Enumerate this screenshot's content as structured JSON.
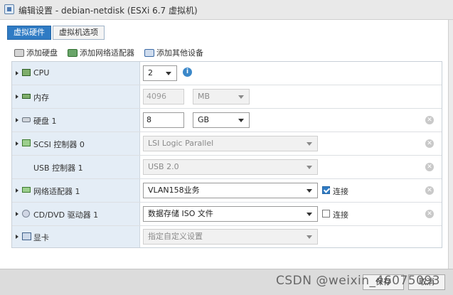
{
  "window": {
    "title": "编辑设置 - debian-netdisk (ESXi 6.7 虚拟机)"
  },
  "tabs": [
    {
      "label": "虚拟硬件",
      "active": true
    },
    {
      "label": "虚拟机选项",
      "active": false
    }
  ],
  "actions": {
    "add_disk": "添加硬盘",
    "add_nic": "添加网络适配器",
    "add_other": "添加其他设备"
  },
  "devices": {
    "cpu": {
      "label": "CPU",
      "value": "2"
    },
    "memory": {
      "label": "内存",
      "value": "4096",
      "unit": "MB"
    },
    "disk": {
      "label": "硬盘 1",
      "value": "8",
      "unit": "GB"
    },
    "scsi": {
      "label": "SCSI 控制器 0",
      "value": "LSI Logic Parallel"
    },
    "usb": {
      "label": "USB 控制器 1",
      "value": "USB 2.0"
    },
    "network": {
      "label": "网络适配器 1",
      "value": "VLAN158业务",
      "connect_label": "连接",
      "connected": true
    },
    "cddvd": {
      "label": "CD/DVD 驱动器 1",
      "value": "数据存储 ISO 文件",
      "connect_label": "连接",
      "connected": false
    },
    "video": {
      "label": "显卡",
      "value": "指定自定义设置"
    }
  },
  "footer": {
    "save_label": "保存",
    "cancel_label": "取消"
  },
  "watermark": "CSDN @weixin_46075093",
  "colors": {
    "accent": "#2f7bc4",
    "label_bg": "#e4edf6"
  }
}
